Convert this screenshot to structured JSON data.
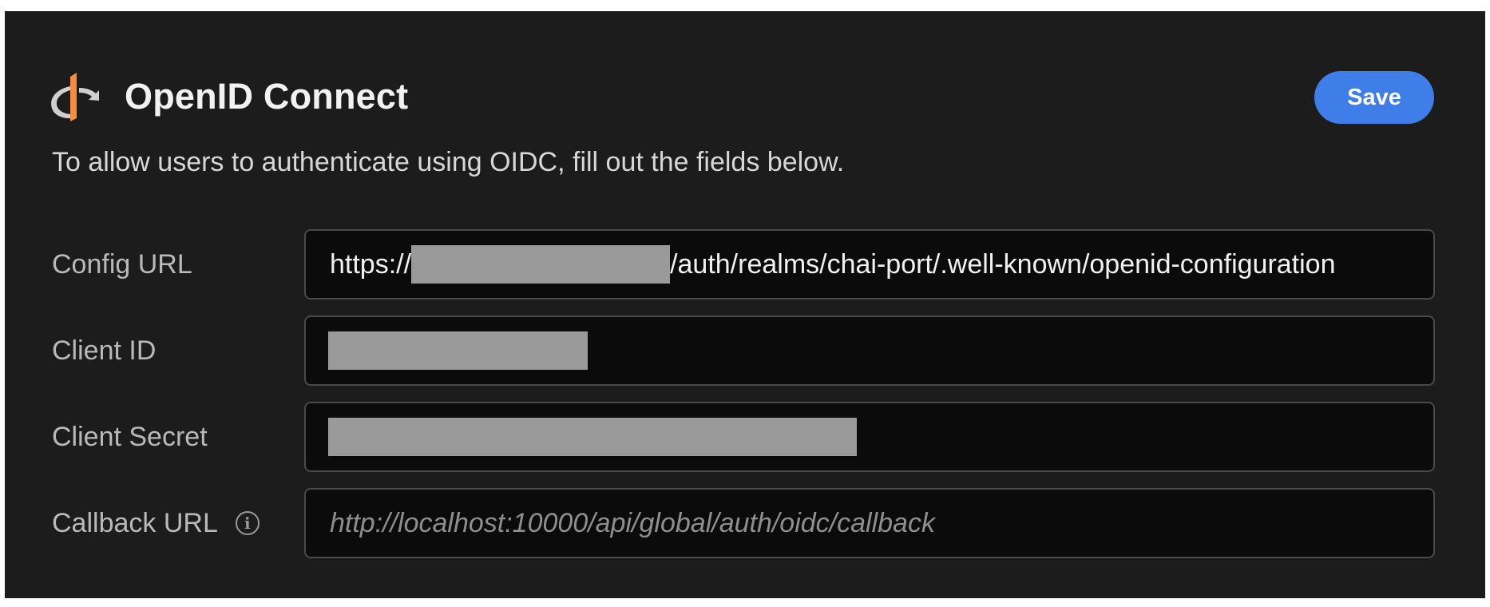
{
  "header": {
    "title": "OpenID Connect",
    "logo_icon": "openid-logo-icon"
  },
  "toolbar": {
    "save_label": "Save"
  },
  "description": "To allow users to authenticate using OIDC, fill out the fields below.",
  "fields": {
    "config_url": {
      "label": "Config URL",
      "value_prefix": "https://",
      "value_suffix": "/auth/realms/chai-port/.well-known/openid-configuration"
    },
    "client_id": {
      "label": "Client ID"
    },
    "client_secret": {
      "label": "Client Secret"
    },
    "callback_url": {
      "label": "Callback URL",
      "info_icon": "info-icon",
      "placeholder": "http://localhost:10000/api/global/auth/oidc/callback"
    }
  },
  "colors": {
    "panel_background": "#1c1c1d",
    "accent": "#3f7de8",
    "logo_orange": "#f78c40",
    "redaction": "#9a9a9a"
  }
}
